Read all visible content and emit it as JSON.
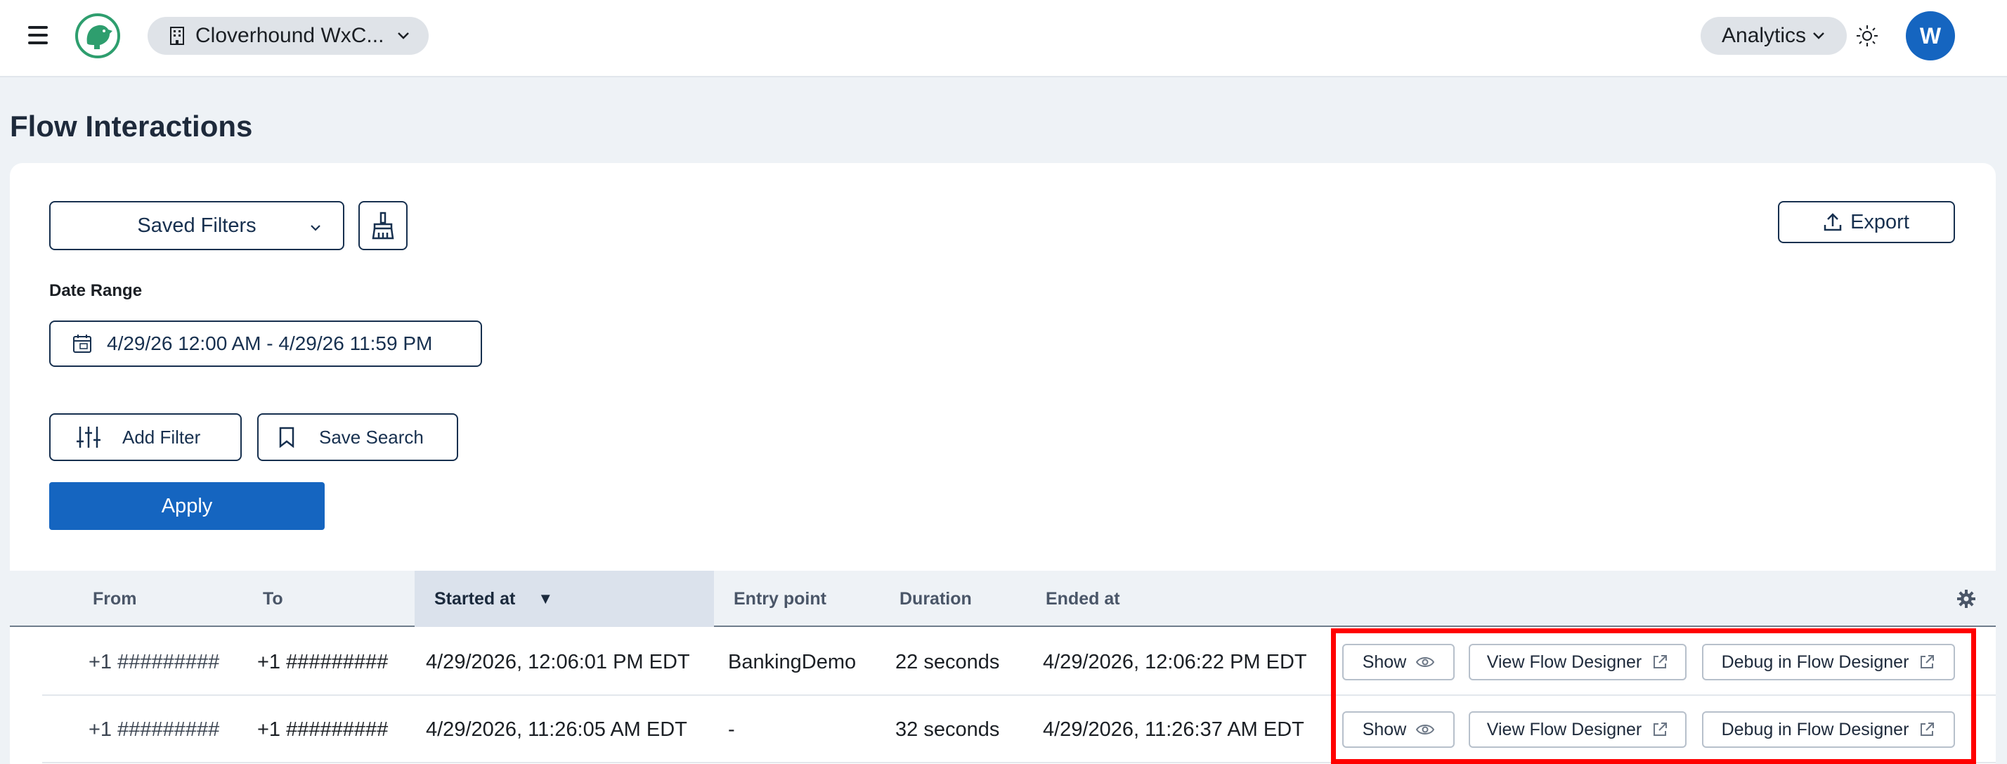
{
  "header": {
    "org_name": "Cloverhound WxC...",
    "analytics_label": "Analytics",
    "avatar_initial": "W",
    "colors": {
      "avatar": "#1565c0",
      "pill": "#dfe3e8",
      "logo": "#2e9e6e"
    }
  },
  "page": {
    "title": "Flow Interactions"
  },
  "filters": {
    "saved_filters_label": "Saved Filters",
    "export_label": "Export",
    "date_range_label": "Date Range",
    "date_range_value": "4/29/26 12:00 AM - 4/29/26 11:59 PM",
    "add_filter_label": "Add Filter",
    "save_search_label": "Save Search",
    "apply_label": "Apply",
    "colors": {
      "apply": "#1565c0",
      "outline": "#17304f"
    }
  },
  "table": {
    "columns": {
      "from": "From",
      "to": "To",
      "started_at": "Started at",
      "entry_point": "Entry point",
      "duration": "Duration",
      "ended_at": "Ended at"
    },
    "sort_indicator": "▼",
    "rows": [
      {
        "from": "+1 #########",
        "to": "+1 #########",
        "started_at": "4/29/2026, 12:06:01 PM EDT",
        "entry_point": "BankingDemo",
        "duration": "22 seconds",
        "ended_at": "4/29/2026, 12:06:22 PM EDT",
        "actions": {
          "show": "Show",
          "view": "View Flow Designer",
          "debug": "Debug in Flow Designer"
        }
      },
      {
        "from": "+1 #########",
        "to": "+1 #########",
        "started_at": "4/29/2026, 11:26:05 AM EDT",
        "entry_point": "-",
        "duration": "32 seconds",
        "ended_at": "4/29/2026, 11:26:37 AM EDT",
        "actions": {
          "show": "Show",
          "view": "View Flow Designer",
          "debug": "Debug in Flow Designer"
        }
      }
    ]
  },
  "annotation": {
    "highlight_color": "#ff0000"
  }
}
